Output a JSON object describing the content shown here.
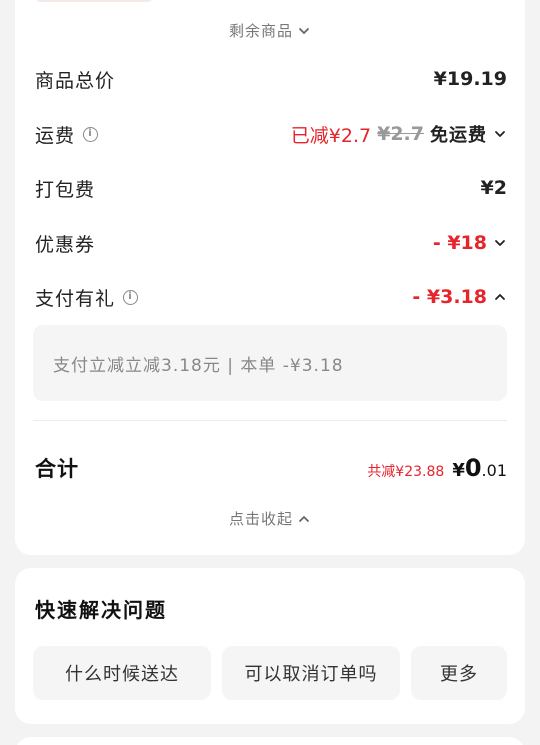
{
  "summary": {
    "remaining_items": "剩余商品",
    "rows": {
      "goods_total": {
        "label": "商品总价",
        "value": "¥19.19"
      },
      "delivery": {
        "label": "运费",
        "reduced": "已减¥2.7",
        "original": "¥2.7",
        "status": "免运费"
      },
      "packing": {
        "label": "打包费",
        "value": "¥2"
      },
      "coupon": {
        "label": "优惠券",
        "value": "- ¥18"
      },
      "pay_gift": {
        "label": "支付有礼",
        "value": "- ¥3.18"
      }
    },
    "pay_gift_detail": "支付立减立减3.18元 | 本单 -¥3.18",
    "total": {
      "label": "合计",
      "saved": "共减¥23.88",
      "currency": "¥",
      "integer": "0",
      "decimal": ".01"
    },
    "collapse": "点击收起"
  },
  "help": {
    "title": "快速解决问题",
    "chips": [
      "什么时候送达",
      "可以取消订单吗",
      "更多"
    ]
  },
  "colors": {
    "accent_red": "#e6242b",
    "background": "#f3f3f3",
    "card": "#ffffff"
  },
  "icons": [
    "info-icon",
    "chevron-down-icon",
    "chevron-up-icon"
  ]
}
